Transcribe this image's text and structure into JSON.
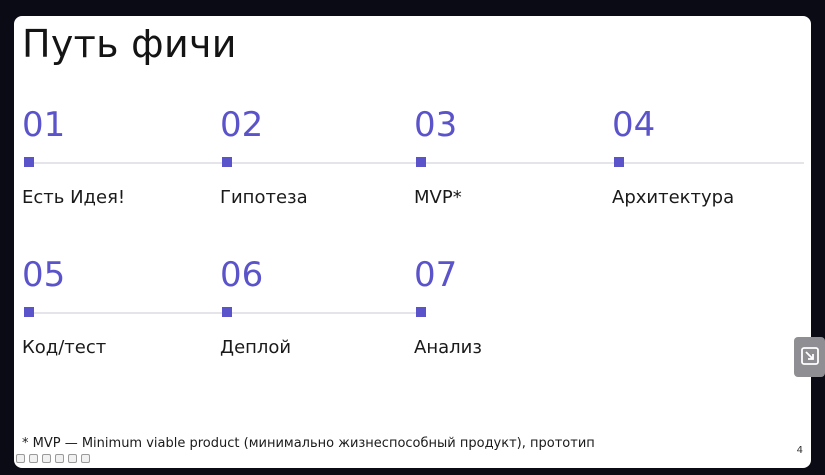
{
  "slide": {
    "title": "Путь фичи",
    "steps": [
      {
        "number": "01",
        "label": "Есть Идея!"
      },
      {
        "number": "02",
        "label": "Гипотеза"
      },
      {
        "number": "03",
        "label": "MVP*"
      },
      {
        "number": "04",
        "label": "Архитектура"
      },
      {
        "number": "05",
        "label": "Код/тест"
      },
      {
        "number": "06",
        "label": "Деплой"
      },
      {
        "number": "07",
        "label": "Анализ"
      }
    ],
    "footnote": "* MVP — Minimum viable product (минимально жизнеспособный продукт), прототип",
    "page_number": "4"
  },
  "colors": {
    "accent": "#5b53c9",
    "background": "#0b0b16",
    "slide": "#ffffff"
  },
  "icons": {
    "toolbar": [
      "zoom-icon",
      "slides-icon",
      "previous-icon",
      "pen-icon",
      "pointer-icon",
      "captions-icon"
    ],
    "side_button": "exit-screen-icon"
  }
}
